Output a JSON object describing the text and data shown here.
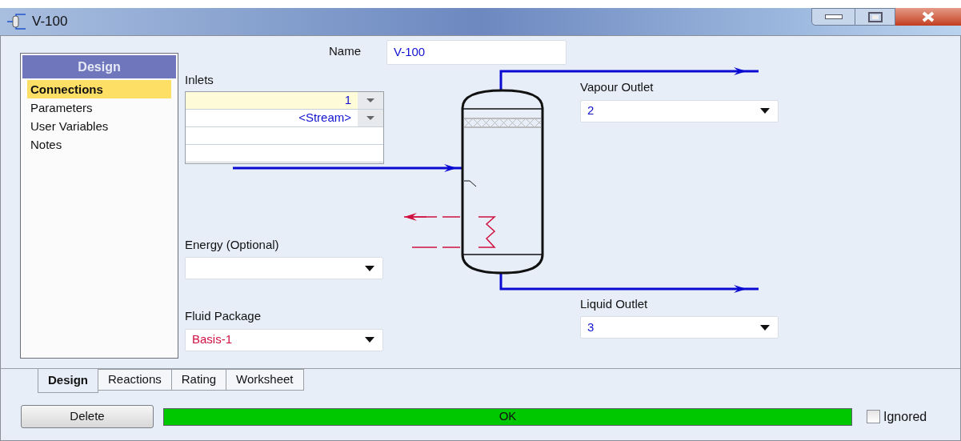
{
  "window": {
    "title": "V-100"
  },
  "sidebar": {
    "header": "Design",
    "items": [
      {
        "label": "Connections",
        "selected": true
      },
      {
        "label": "Parameters",
        "selected": false
      },
      {
        "label": "User Variables",
        "selected": false
      },
      {
        "label": "Notes",
        "selected": false
      }
    ]
  },
  "name": {
    "label": "Name",
    "value": "V-100"
  },
  "inlets": {
    "label": "Inlets",
    "rows": [
      {
        "value": "1",
        "selected": true
      },
      {
        "value": "<Stream>",
        "selected": false
      }
    ]
  },
  "energy": {
    "label": "Energy (Optional)"
  },
  "fluid_package": {
    "label": "Fluid Package",
    "value": "Basis-1"
  },
  "vapour_outlet": {
    "label": "Vapour Outlet",
    "value": "2"
  },
  "liquid_outlet": {
    "label": "Liquid Outlet",
    "value": "3"
  },
  "tabs": [
    {
      "label": "Design",
      "selected": true
    },
    {
      "label": "Reactions",
      "selected": false
    },
    {
      "label": "Rating",
      "selected": false
    },
    {
      "label": "Worksheet",
      "selected": false
    }
  ],
  "delete_button": "Delete",
  "status": {
    "text": "OK"
  },
  "ignored": {
    "label": "Ignored",
    "checked": false
  }
}
